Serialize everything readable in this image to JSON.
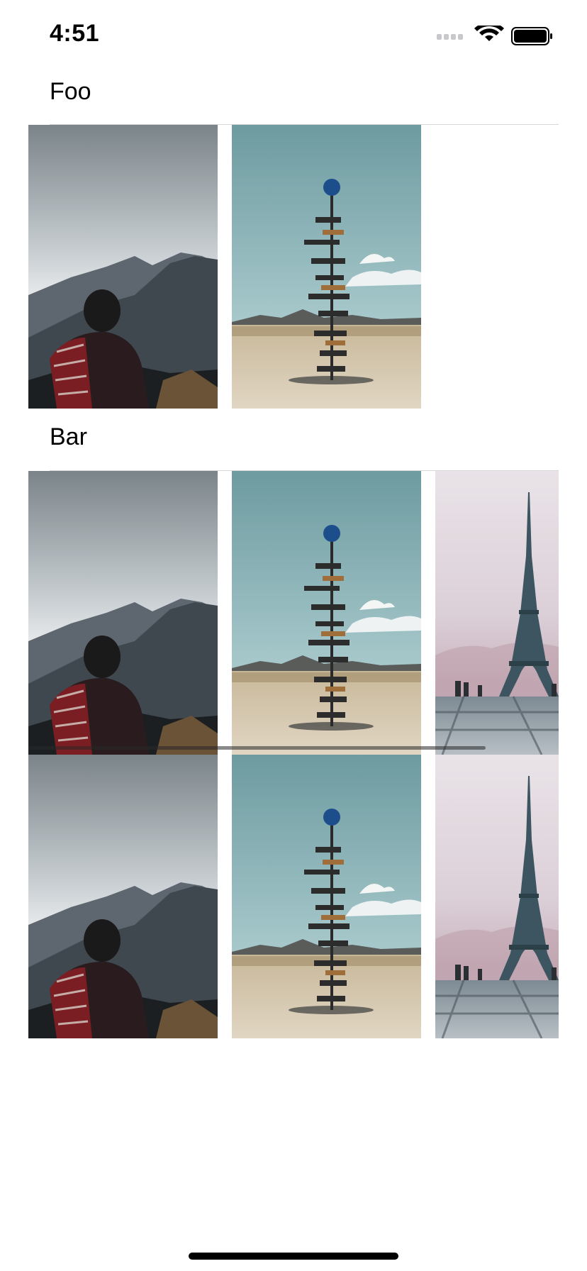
{
  "status_bar": {
    "time": "4:51",
    "icons": [
      "cellular-signal-icon",
      "wifi-icon",
      "battery-icon"
    ]
  },
  "sections": [
    {
      "title": "Foo",
      "rows": [
        [
          "mountain-hiker-photo",
          "desert-signpost-photo"
        ]
      ]
    },
    {
      "title": "Bar",
      "rows": [
        [
          "mountain-hiker-photo",
          "desert-signpost-photo",
          "eiffel-tower-photo"
        ],
        [
          "mountain-hiker-photo",
          "desert-signpost-photo",
          "eiffel-tower-photo"
        ]
      ]
    }
  ],
  "colors": {
    "background": "#ffffff",
    "separator": "#d8d8d8",
    "text": "#000000"
  }
}
